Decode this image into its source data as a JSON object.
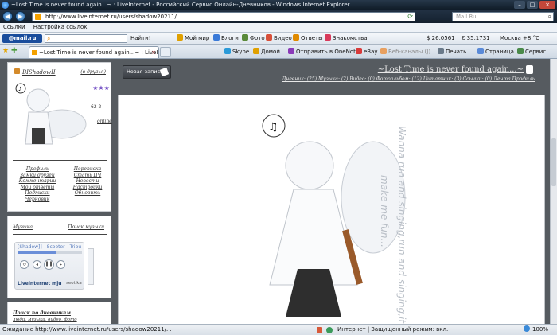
{
  "window": {
    "title": "~Lost Time is never found again...~ : LiveInternet - Российский Сервис Онлайн-Дневников - Windows Internet Explorer",
    "buttons": [
      "–",
      "□",
      "×"
    ]
  },
  "address_bar": {
    "url": "http://www.liveinternet.ru/users/shadow20211/",
    "search_placeholder": "Mail.Ru"
  },
  "links_bar": {
    "items": [
      "Ссылки",
      "Настройка ссылок"
    ]
  },
  "mail_toolbar": {
    "logo": "@mail.ru",
    "find_label": "Найти!",
    "items": [
      "Мой мир",
      "Блоги",
      "Фото",
      "Видео",
      "Ответы",
      "Знакомства"
    ],
    "usd_rate": "$ 26.0561",
    "eur_rate": "€ 35.1731",
    "weather": "Москва +8 °C"
  },
  "tab": {
    "title": "~Lost Time is never found again...~ : LiveInternet..."
  },
  "command_bar": {
    "items": [
      "Skype",
      "Домой",
      "Отправить в OneNote",
      "eBay",
      "Веб-каналы (J)",
      "Печать",
      "Страница",
      "Сервис"
    ],
    "colors": {
      "skype": "#2a9ad8",
      "home": "#e0a000",
      "onenote": "#8a3ab8",
      "ebay": "#d83a3a"
    }
  },
  "profile": {
    "username": "BIShadowII",
    "friends_link": "(в друзья)",
    "stars": "★★★",
    "counts": "62  2",
    "online": "online",
    "links_left": [
      "Профиль",
      "Замки друзей",
      "Комментарии",
      "Мои ответы",
      "Подписки",
      "Черновик"
    ],
    "links_right": [
      "Переписка",
      "Стать ПЧ",
      "Новости",
      "Настройки",
      "Обновить"
    ]
  },
  "music": {
    "title": "Музыка",
    "search": "Поиск музыки",
    "player": {
      "track": "[Shadow]] - Scooter - Tribu",
      "brand": "Liveinternet",
      "mju": "mju",
      "user": "seotika",
      "progress": 0.6
    }
  },
  "diary_search": {
    "title": "Поиск по дневникам",
    "filters": "люди, музыка, видео, фото"
  },
  "post": {
    "new_post_label": "Новая запись"
  },
  "diary": {
    "title": "~Lost Time is never found again...~",
    "links": "Дневник: (25)  Музыка: (2)  Видео: (0)  Фотоальбом: (12)  Цитатник: (3)  Ссылки: (0)  Лента  Профиль",
    "lyrics_line1": "Wanna run and singing,run and singing,it's",
    "lyrics_line2": "make me fun..."
  },
  "status_bar": {
    "message": "Ожидание http://www.liveinternet.ru/users/shadow20211/...",
    "zone": "Интернет | Защищенный режим: вкл.",
    "zoom": "100%"
  }
}
